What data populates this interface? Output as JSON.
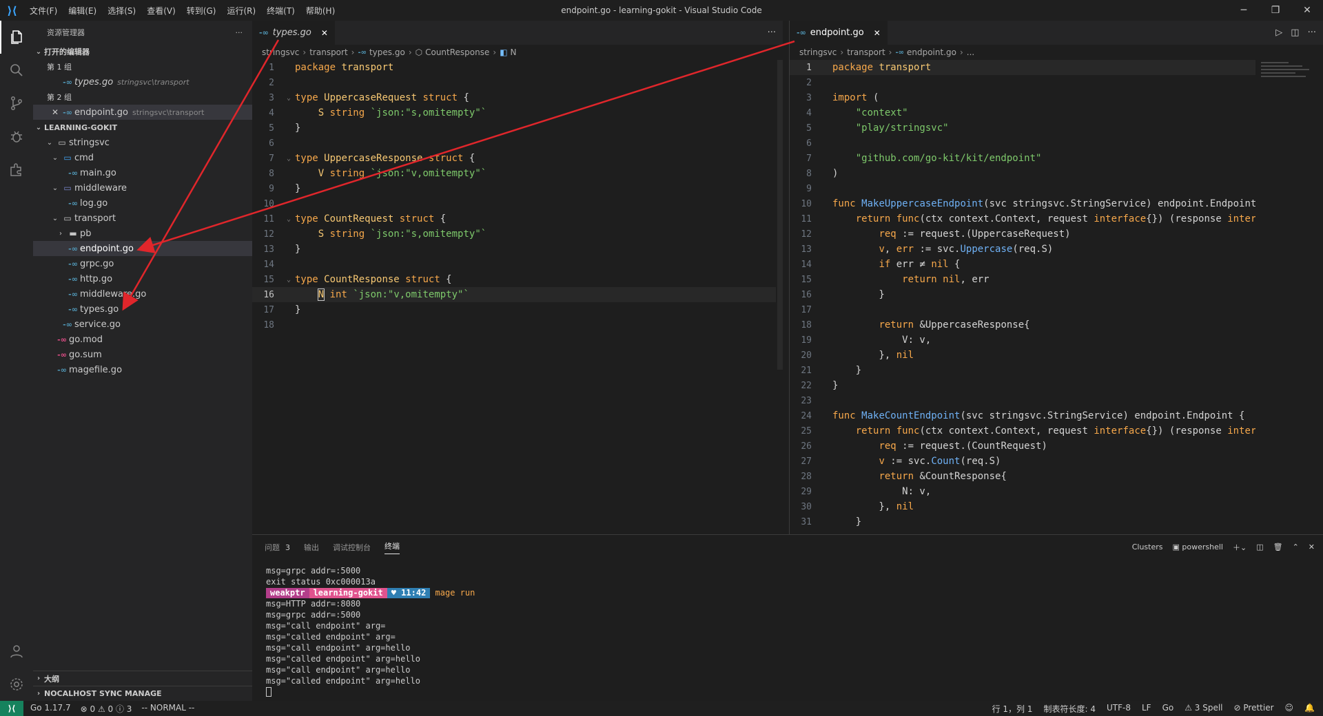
{
  "window": {
    "title": "endpoint.go - learning-gokit - Visual Studio Code",
    "menu": [
      "文件(F)",
      "编辑(E)",
      "选择(S)",
      "查看(V)",
      "转到(G)",
      "运行(R)",
      "终端(T)",
      "帮助(H)"
    ]
  },
  "sidebar": {
    "title": "资源管理器",
    "open_editors": "打开的编辑器",
    "group1": "第 1 组",
    "group1_file": "types.go",
    "group1_path": "stringsvc\\transport",
    "group2": "第 2 组",
    "group2_file": "endpoint.go",
    "group2_path": "stringsvc\\transport",
    "project": "LEARNING-GOKIT",
    "tree": {
      "stringsvc": "stringsvc",
      "cmd": "cmd",
      "main": "main.go",
      "middleware": "middleware",
      "log": "log.go",
      "transport": "transport",
      "pb": "pb",
      "endpoint": "endpoint.go",
      "grpc": "grpc.go",
      "http": "http.go",
      "middleware_go": "middleware.go",
      "types": "types.go",
      "service": "service.go",
      "gomod": "go.mod",
      "gosum": "go.sum",
      "magefile": "magefile.go"
    },
    "outline": "大纲",
    "nocalhost": "NOCALHOST SYNC MANAGE"
  },
  "editor_left": {
    "tab": "types.go",
    "breadcrumb": [
      "stringsvc",
      "transport",
      "types.go",
      "CountResponse",
      "N"
    ]
  },
  "editor_right": {
    "tab": "endpoint.go",
    "breadcrumb": [
      "stringsvc",
      "transport",
      "endpoint.go",
      "..."
    ]
  },
  "panel": {
    "tabs": [
      "问题",
      "输出",
      "调试控制台",
      "终端"
    ],
    "problems_count": "3",
    "clusters": "Clusters",
    "shell": "powershell",
    "terminal": {
      "l1": "msg=grpc addr=:5000",
      "l2": "exit status 0xc000013a",
      "prompt_user": "weakptr",
      "prompt_repo": "learning-gokit",
      "prompt_time": "♥ 11:42",
      "prompt_cmd": "mage run",
      "l4": "msg=HTTP addr=:8080",
      "l5": "msg=grpc addr=:5000",
      "l6": "msg=\"call endpoint\" arg=",
      "l7": "msg=\"called endpoint\" arg=",
      "l8": "msg=\"call endpoint\" arg=hello",
      "l9": "msg=\"called endpoint\" arg=hello",
      "l10": "msg=\"call endpoint\" arg=hello",
      "l11": "msg=\"called endpoint\" arg=hello"
    }
  },
  "statusbar": {
    "go_version": "Go 1.17.7",
    "problems": "⊗ 0 ⚠ 0 ⓘ 3",
    "mode": "-- NORMAL --",
    "position": "行 1，列 1",
    "tabsize": "制表符长度: 4",
    "encoding": "UTF-8",
    "eol": "LF",
    "language": "Go",
    "spell": "⚠ 3 Spell",
    "prettier": "⊘ Prettier"
  },
  "colors": {
    "accent": "#3aa5ff",
    "arrow": "#e0262b",
    "go_icon": "#519aba"
  }
}
